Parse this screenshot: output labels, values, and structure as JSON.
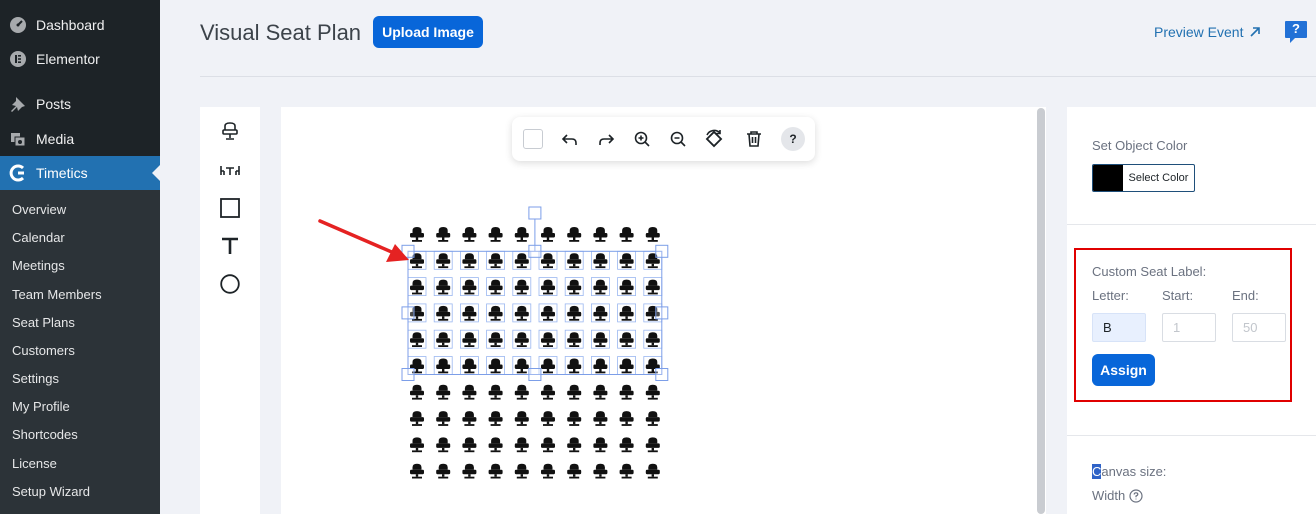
{
  "sidebar": {
    "top_items": [
      {
        "label": "Dashboard",
        "icon": "dashboard-icon"
      },
      {
        "label": "Elementor",
        "icon": "elementor-icon"
      },
      {
        "label": "Posts",
        "icon": "pin-icon"
      },
      {
        "label": "Media",
        "icon": "media-icon"
      },
      {
        "label": "Timetics",
        "icon": "timetics-icon",
        "active": true
      }
    ],
    "sub_items": [
      "Overview",
      "Calendar",
      "Meetings",
      "Team Members",
      "Seat Plans",
      "Customers",
      "Settings",
      "My Profile",
      "Shortcodes",
      "License",
      "Setup Wizard"
    ]
  },
  "header": {
    "title": "Visual Seat Plan",
    "upload_label": "Upload Image",
    "preview_label": "Preview Event",
    "help_label": "?"
  },
  "tools": [
    "seat-tool-icon",
    "table-tool-icon",
    "rectangle-tool-icon",
    "text-tool-icon",
    "circle-tool-icon"
  ],
  "toolbar": {
    "items": [
      "select-checkbox",
      "undo-icon",
      "redo-icon",
      "zoom-in-icon",
      "zoom-out-icon",
      "rotate-icon",
      "delete-icon",
      "help-icon"
    ],
    "help_label": "?"
  },
  "seat_grid": {
    "rows": 10,
    "cols": 10,
    "selected_rows": [
      1,
      5
    ]
  },
  "right_panel": {
    "object_color_label": "Set Object Color",
    "select_color_label": "Select Color",
    "selected_color": "#000000",
    "custom_seat_label_title": "Custom Seat Label:",
    "letter_label": "Letter:",
    "start_label": "Start:",
    "end_label": "End:",
    "letter_value": "B",
    "start_placeholder": "1",
    "end_placeholder": "50",
    "assign_label": "Assign",
    "canvas_size_cursor": "C",
    "canvas_size_rest": "anvas size:",
    "width_label": "Width"
  },
  "colors": {
    "sidebar_bg": "#1d2327",
    "submenu_bg": "#2c3338",
    "active_menu": "#2271b1",
    "primary_button": "#0866d9",
    "highlight_border": "#e00000",
    "arrow": "#e52222"
  }
}
